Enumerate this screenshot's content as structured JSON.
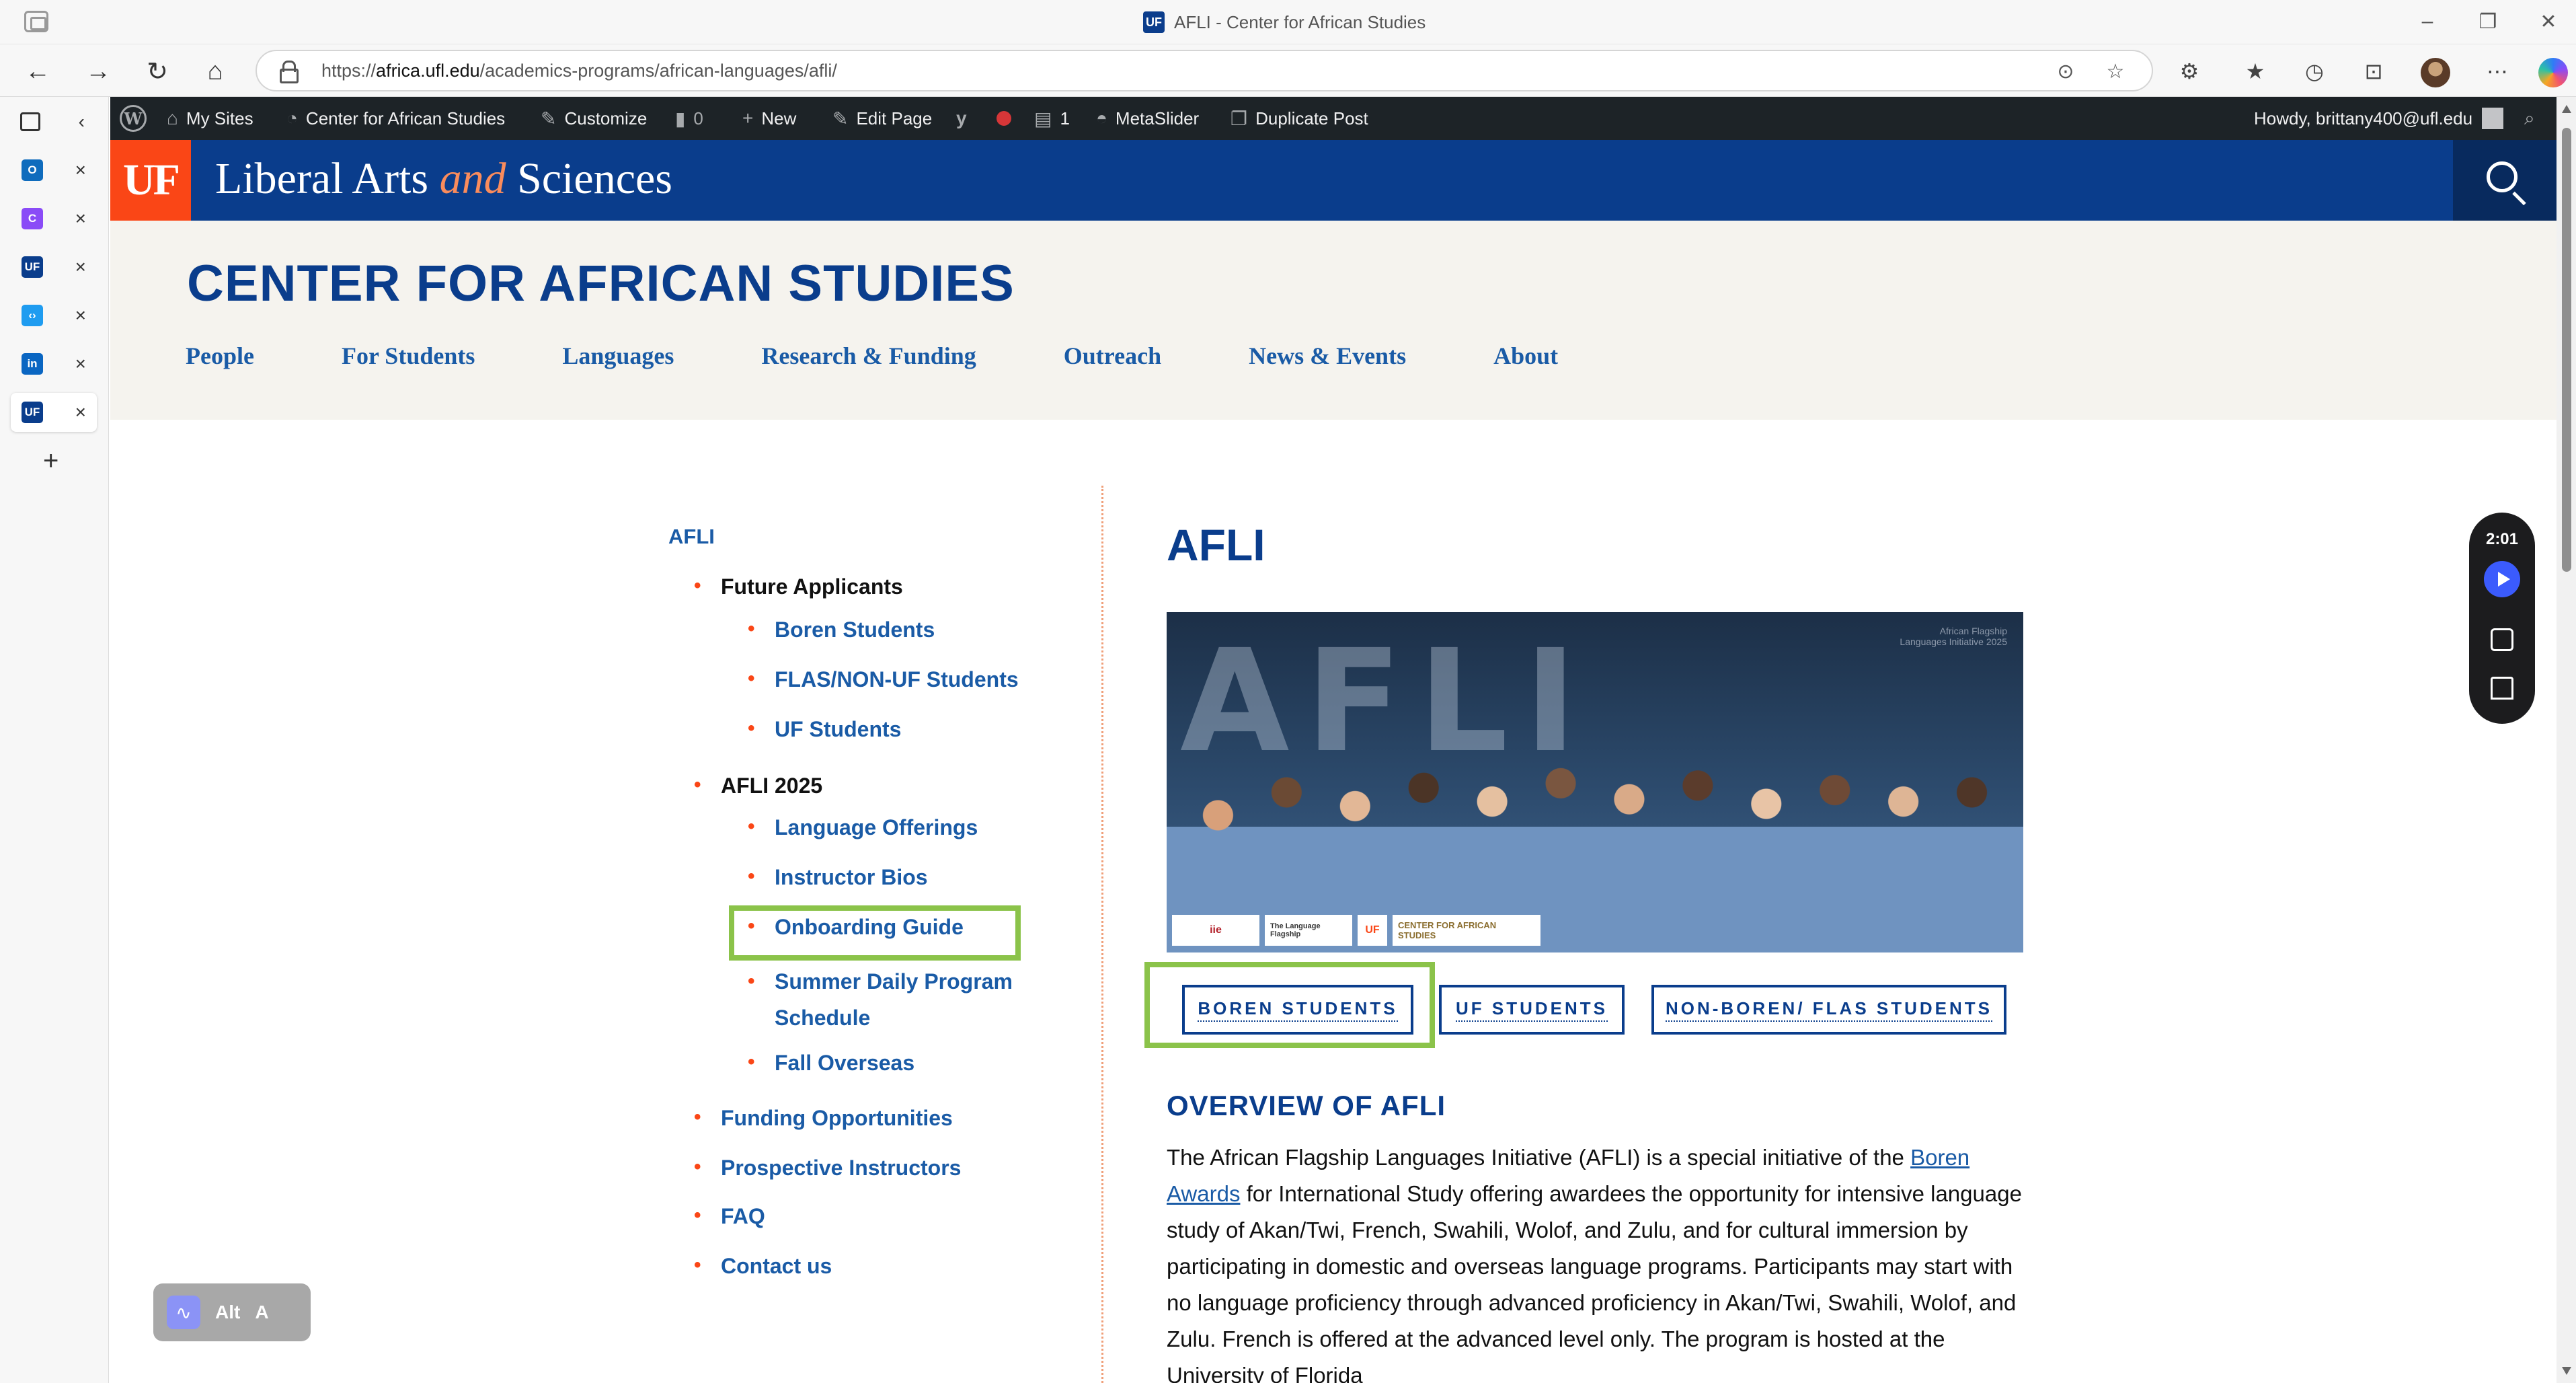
{
  "browser": {
    "title": "AFLI - Center for African Studies",
    "favicon_text": "UF",
    "url_prefix": "https://",
    "url_domain": "africa.ufl.edu",
    "url_path": "/academics-programs/african-languages/afli/",
    "vertical_tabs": [
      {
        "icon": "outlook-icon",
        "color": "#0f6cbd",
        "text": "O"
      },
      {
        "icon": "copilot-icon",
        "color": "#8a4bf7",
        "text": "C"
      },
      {
        "icon": "uf-icon",
        "color": "#0a3d8c",
        "text": "UF"
      },
      {
        "icon": "vscode-icon",
        "color": "#1f9cf0",
        "text": "‹›"
      },
      {
        "icon": "linkedin-icon",
        "color": "#0a66c2",
        "text": "in"
      },
      {
        "icon": "uf-icon",
        "color": "#0a3d8c",
        "text": "UF"
      }
    ]
  },
  "wp_admin": {
    "my_sites": "My Sites",
    "site_name": "Center for African Studies",
    "customize": "Customize",
    "comments_count": "0",
    "new": "New",
    "edit_page": "Edit Page",
    "updates_count": "1",
    "metaslider": "MetaSlider",
    "duplicate": "Duplicate Post",
    "howdy": "Howdy, brittany400@ufl.edu"
  },
  "uf_header": {
    "logo": "UF",
    "brand_part1": "Liberal Arts ",
    "brand_and": "and",
    "brand_part2": " Sciences"
  },
  "site": {
    "title": "CENTER FOR AFRICAN STUDIES",
    "nav": [
      "People",
      "For Students",
      "Languages",
      "Research & Funding",
      "Outreach",
      "News & Events",
      "About"
    ]
  },
  "sidenav": {
    "top": "AFLI",
    "future_applicants": "Future Applicants",
    "boren": "Boren Students",
    "flas": "FLAS/NON-UF Students",
    "uf_students": "UF Students",
    "afli_2025": "AFLI 2025",
    "language_offerings": "Language Offerings",
    "instructor_bios": "Instructor Bios",
    "onboarding": "Onboarding Guide",
    "summer_line1": "Summer Daily Program",
    "summer_line2": "Schedule",
    "fall_overseas": "Fall Overseas",
    "funding": "Funding Opportunities",
    "prospective": "Prospective Instructors",
    "faq": "FAQ",
    "contact": "Contact us"
  },
  "main": {
    "title": "AFLI",
    "hero_lettering": "AFLI",
    "hero_tagline_1": "African Flagship",
    "hero_tagline_2": "Languages Initiative 2025",
    "sponsors": [
      "iie",
      "The Language Flagship",
      "UF",
      "CENTER FOR AFRICAN STUDIES"
    ],
    "buttons": [
      "BOREN STUDENTS",
      "UF STUDENTS",
      "NON-BOREN/ FLAS STUDENTS"
    ],
    "overview_heading": "OVERVIEW OF AFLI",
    "para_before": "The African Flagship Languages Initiative (AFLI) is a special initiative of the ",
    "para_link": "Boren Awards",
    "para_after": " for International Study offering awardees the opportunity for intensive language study of Akan/Twi, French, Swahili, Wolof, and Zulu, and for cultural immersion by participating in domestic and overseas language programs. Participants may start with no language proficiency through advanced proficiency in Akan/Twi, Swahili, Wolof, and Zulu. French is offered at the advanced level only. The program is hosted at the University of Florida"
  },
  "widgets": {
    "recorder_time": "2:01",
    "a11y_alt": "Alt",
    "a11y_a": "A"
  },
  "colors": {
    "uf_blue": "#0a3d8c",
    "uf_orange": "#fa4616",
    "highlight": "#8bc34a"
  }
}
